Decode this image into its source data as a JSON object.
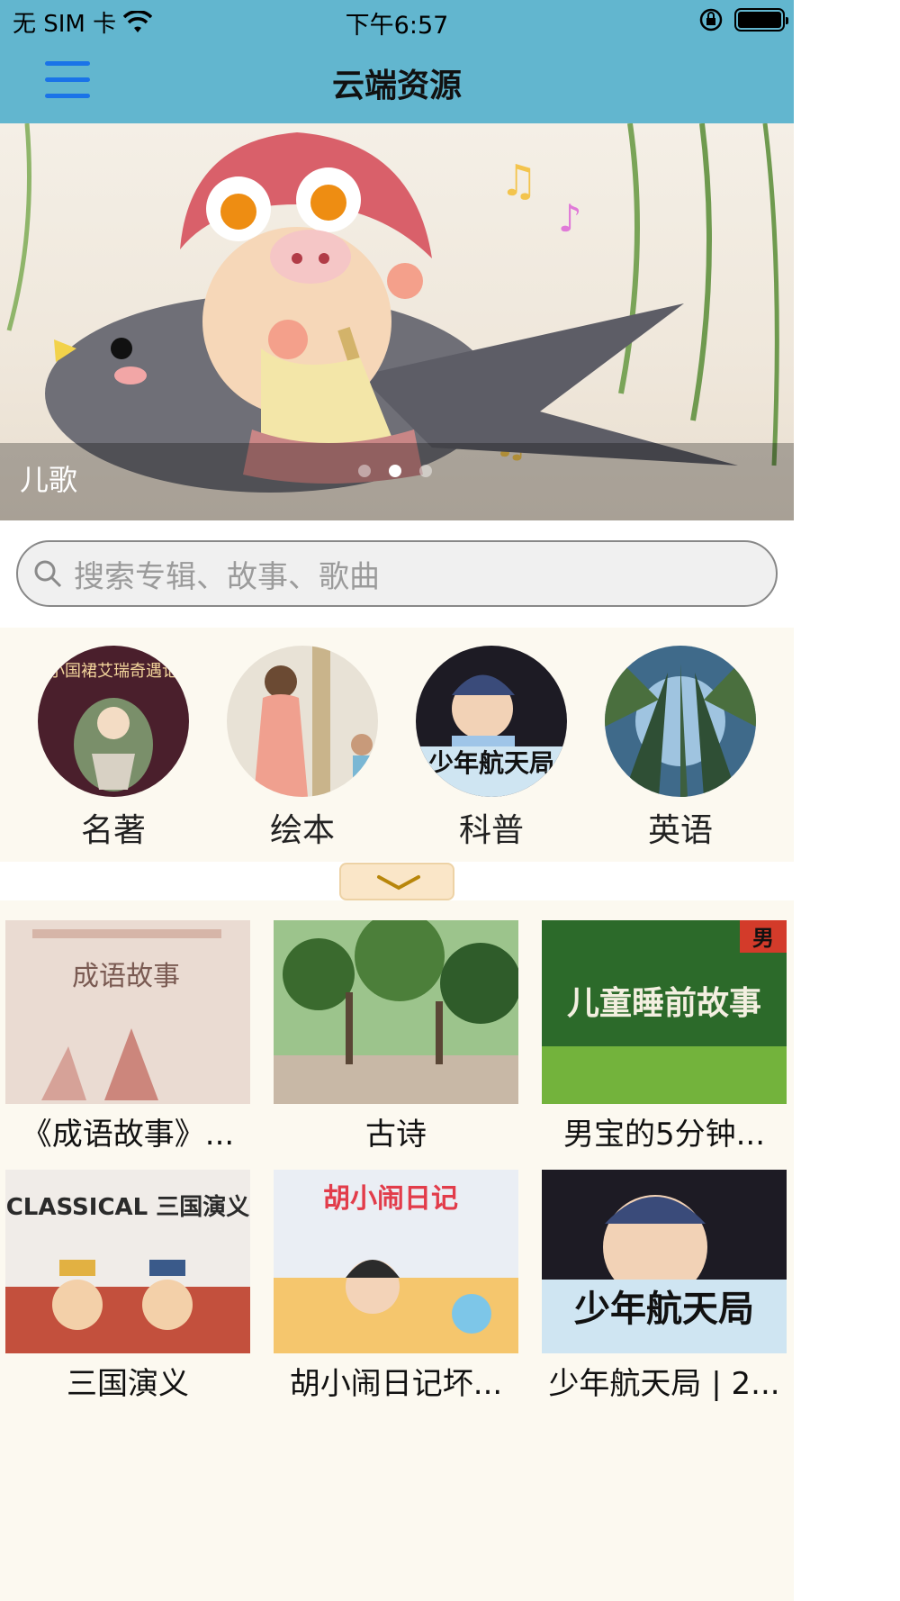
{
  "status_bar": {
    "carrier": "无 SIM 卡",
    "time": "下午6:57"
  },
  "nav": {
    "title": "云端资源",
    "menu_icon": "hamburger-menu-icon"
  },
  "banner": {
    "caption": "儿歌",
    "active_dot": 2,
    "dot_count": 3
  },
  "search": {
    "placeholder": "搜索专辑、故事、歌曲"
  },
  "categories": [
    {
      "label": "名著",
      "thumb_text": "小国裙艾瑞奇遇记"
    },
    {
      "label": "绘本"
    },
    {
      "label": "科普",
      "thumb_text": "少年航天局"
    },
    {
      "label": "英语"
    }
  ],
  "expand": {
    "icon": "chevron-down-icon"
  },
  "albums": [
    {
      "title": "《成语故事》...",
      "thumb_text": "成语故事"
    },
    {
      "title": "古诗"
    },
    {
      "title": "男宝的5分钟...",
      "thumb_text": "儿童睡前故事",
      "badge": "男"
    },
    {
      "title": "三国演义",
      "thumb_text": "CLASSICAL 三国演义"
    },
    {
      "title": "胡小闹日记坏...",
      "thumb_text": "胡小闹日记"
    },
    {
      "title": "少年航天局 | 2...",
      "thumb_text": "少年航天局"
    }
  ],
  "colors": {
    "header_bg": "#62b6cf",
    "menu_icon": "#1a73e8",
    "panel_bg": "#fcf9f0",
    "expand_bg": "#fae6c8",
    "expand_chevron": "#b8860b"
  }
}
